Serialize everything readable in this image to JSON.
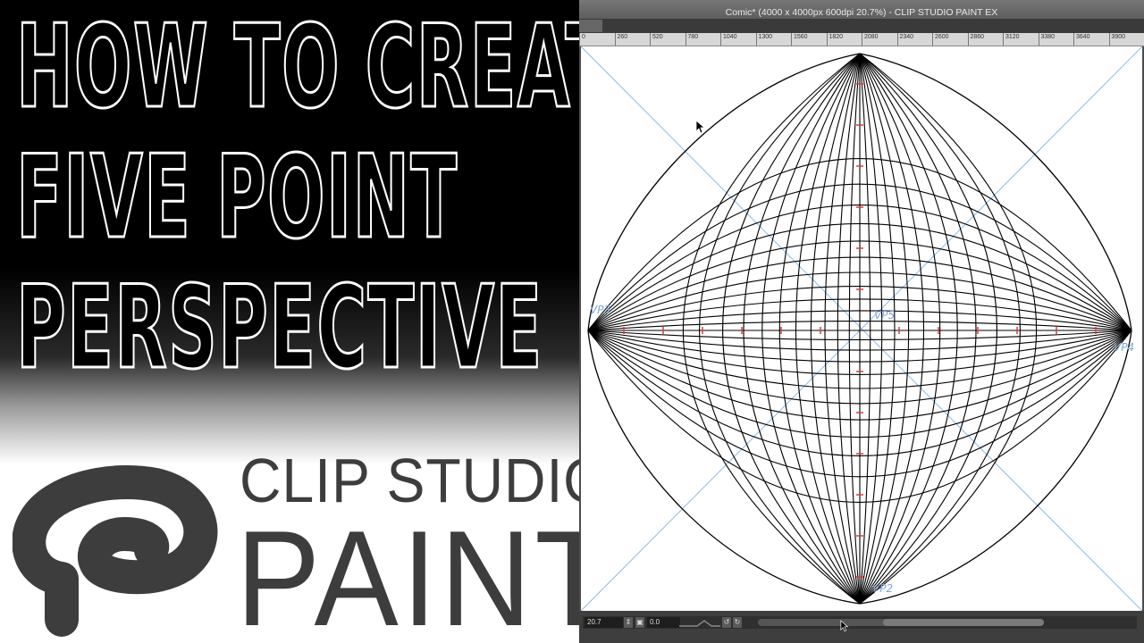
{
  "headline": {
    "line1": "HOW TO CREATE",
    "line2": "FIVE POINT",
    "line3": "PERSPECTIVE"
  },
  "brand": {
    "line1": "CLIP STUDIO",
    "line2": "PAINT"
  },
  "window": {
    "title": "Comic* (4000 x 4000px 600dpi 20.7%)  - CLIP STUDIO PAINT EX"
  },
  "ruler": {
    "ticks": [
      "0",
      "260",
      "520",
      "780",
      "1040",
      "1300",
      "1560",
      "1820",
      "2080",
      "2340",
      "2600",
      "2860",
      "3120",
      "3380",
      "3640",
      "3900"
    ]
  },
  "canvas": {
    "annotations": {
      "left": "VP3",
      "center": "VP5",
      "right": "VP4",
      "bottom": "VP2"
    }
  },
  "status": {
    "zoom": "20.7",
    "angle": "0.0"
  },
  "icons": {
    "cursor": "arrow-cursor-icon",
    "zoom_stepper": "stepper-icon",
    "rotate_left": "rotate-left-icon",
    "rotate_right": "rotate-right-icon"
  },
  "colors": {
    "headline_fill": "#000000",
    "headline_outline": "#ffffff",
    "brand": "#3d3d3d",
    "guide_blue": "#8fb8e6",
    "grid_black": "#000000",
    "marks_red": "#d04040"
  }
}
